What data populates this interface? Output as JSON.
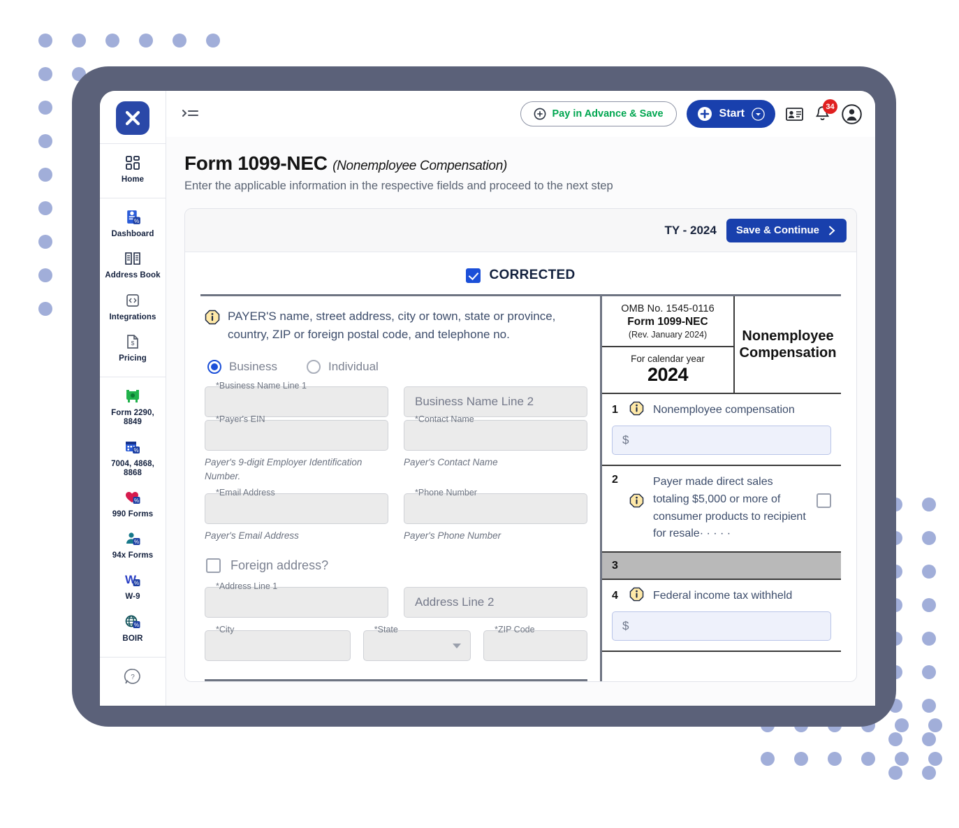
{
  "colors": {
    "brand_blue": "#1940ad",
    "logo_blue": "#2a48a8",
    "accent_green": "#00a650",
    "badge_red": "#e02020",
    "frame_gray": "#5b6179",
    "dot_violet": "#99a7d6",
    "money_field_bg": "#eef1fb",
    "box3_gray": "#b9b9b9"
  },
  "sidebar": {
    "logo_glyph": "X",
    "logo_name": "app-logo",
    "groups": [
      {
        "items": [
          {
            "label": "Home",
            "icon": "grid-dashboard-icon"
          }
        ]
      },
      {
        "items": [
          {
            "label": "Dashboard",
            "icon": "document-percent-icon"
          },
          {
            "label": "Address Book",
            "icon": "open-book-icon"
          },
          {
            "label": "Integrations",
            "icon": "code-brackets-icon"
          },
          {
            "label": "Pricing",
            "icon": "price-tag-document-icon"
          }
        ]
      },
      {
        "items": [
          {
            "label": "Form 2290, 8849",
            "icon": "truck-icon"
          },
          {
            "label": "7004, 4868, 8868",
            "icon": "calendar-percent-icon"
          },
          {
            "label": "990 Forms",
            "icon": "heart-percent-icon"
          },
          {
            "label": "94x Forms",
            "icon": "person-percent-icon"
          },
          {
            "label": "W-9",
            "icon": "w-letter-percent-icon"
          },
          {
            "label": "BOIR",
            "icon": "globe-percent-icon"
          }
        ]
      },
      {
        "items": [
          {
            "label": "",
            "icon": "help-question-icon"
          }
        ]
      }
    ]
  },
  "topbar": {
    "menu_icon": "collapse-menu-icon",
    "pay_in_advance_label": "Pay in Advance & Save",
    "start_label": "Start",
    "contact_card_icon": "contact-card-icon",
    "notification_icon": "bell-icon",
    "notification_count": "34",
    "account_icon": "user-circle-icon"
  },
  "page": {
    "title": "Form 1099-NEC",
    "title_suffix": "(Nonemployee Compensation)",
    "description": "Enter the applicable information in the respective fields and proceed to the next step"
  },
  "card_header": {
    "tax_year": "TY - 2024",
    "save_label": "Save & Continue"
  },
  "form": {
    "corrected_label": "CORRECTED",
    "corrected_checked": true,
    "payer_instruction": "PAYER'S name, street address, city or town, state or province, country, ZIP or foreign postal code, and telephone no.",
    "entity_type": {
      "selected": "Business",
      "options": [
        "Business",
        "Individual"
      ]
    },
    "fields": [
      {
        "label": "*Business Name Line 1",
        "value": "",
        "placeholder": "",
        "hint": "",
        "kind": "outlined"
      },
      {
        "label": "",
        "value": "",
        "placeholder": "Business Name Line 2",
        "hint": "",
        "kind": "plain"
      },
      {
        "label": "*Payer's EIN",
        "value": "",
        "placeholder": "",
        "hint": "Payer's 9-digit Employer Identification Number.",
        "kind": "outlined"
      },
      {
        "label": "*Contact Name",
        "value": "",
        "placeholder": "",
        "hint": "Payer's Contact Name",
        "kind": "outlined"
      },
      {
        "label": "*Email Address",
        "value": "",
        "placeholder": "",
        "hint": "Payer's Email Address",
        "kind": "outlined"
      },
      {
        "label": "*Phone Number",
        "value": "",
        "placeholder": "",
        "hint": "Payer's Phone Number",
        "kind": "outlined"
      }
    ],
    "foreign_address": {
      "label": "Foreign address?",
      "checked": false
    },
    "address_fields": [
      {
        "label": "*Address Line 1",
        "value": "",
        "placeholder": "",
        "kind": "outlined"
      },
      {
        "label": "",
        "value": "",
        "placeholder": "Address Line 2",
        "kind": "plain"
      },
      {
        "label": "*City",
        "value": "",
        "placeholder": "",
        "kind": "outlined"
      },
      {
        "label": "*State",
        "value": "",
        "placeholder": "",
        "kind": "select"
      },
      {
        "label": "*ZIP Code",
        "value": "",
        "placeholder": "",
        "kind": "outlined"
      }
    ]
  },
  "omb": {
    "number": "OMB No. 1545-0116",
    "form_name": "Form 1099-NEC",
    "revision": "(Rev. January 2024)",
    "calendar_year_label": "For calendar year",
    "calendar_year": "2024",
    "title": "Nonemployee Compensation"
  },
  "boxes": [
    {
      "num": "1",
      "label": "Nonemployee compensation",
      "input_prefix": "$",
      "value": "",
      "kind": "money",
      "info": true
    },
    {
      "num": "2",
      "label": "Payer made direct sales totaling $5,000 or more of consumer products to recipient for resale·  ·   ·   ·   ·",
      "kind": "checkbox",
      "checked": false,
      "info": true
    },
    {
      "num": "3",
      "label": "",
      "kind": "shaded",
      "info": false
    },
    {
      "num": "4",
      "label": "Federal income tax withheld",
      "input_prefix": "$",
      "value": "",
      "kind": "money",
      "info": true
    }
  ]
}
